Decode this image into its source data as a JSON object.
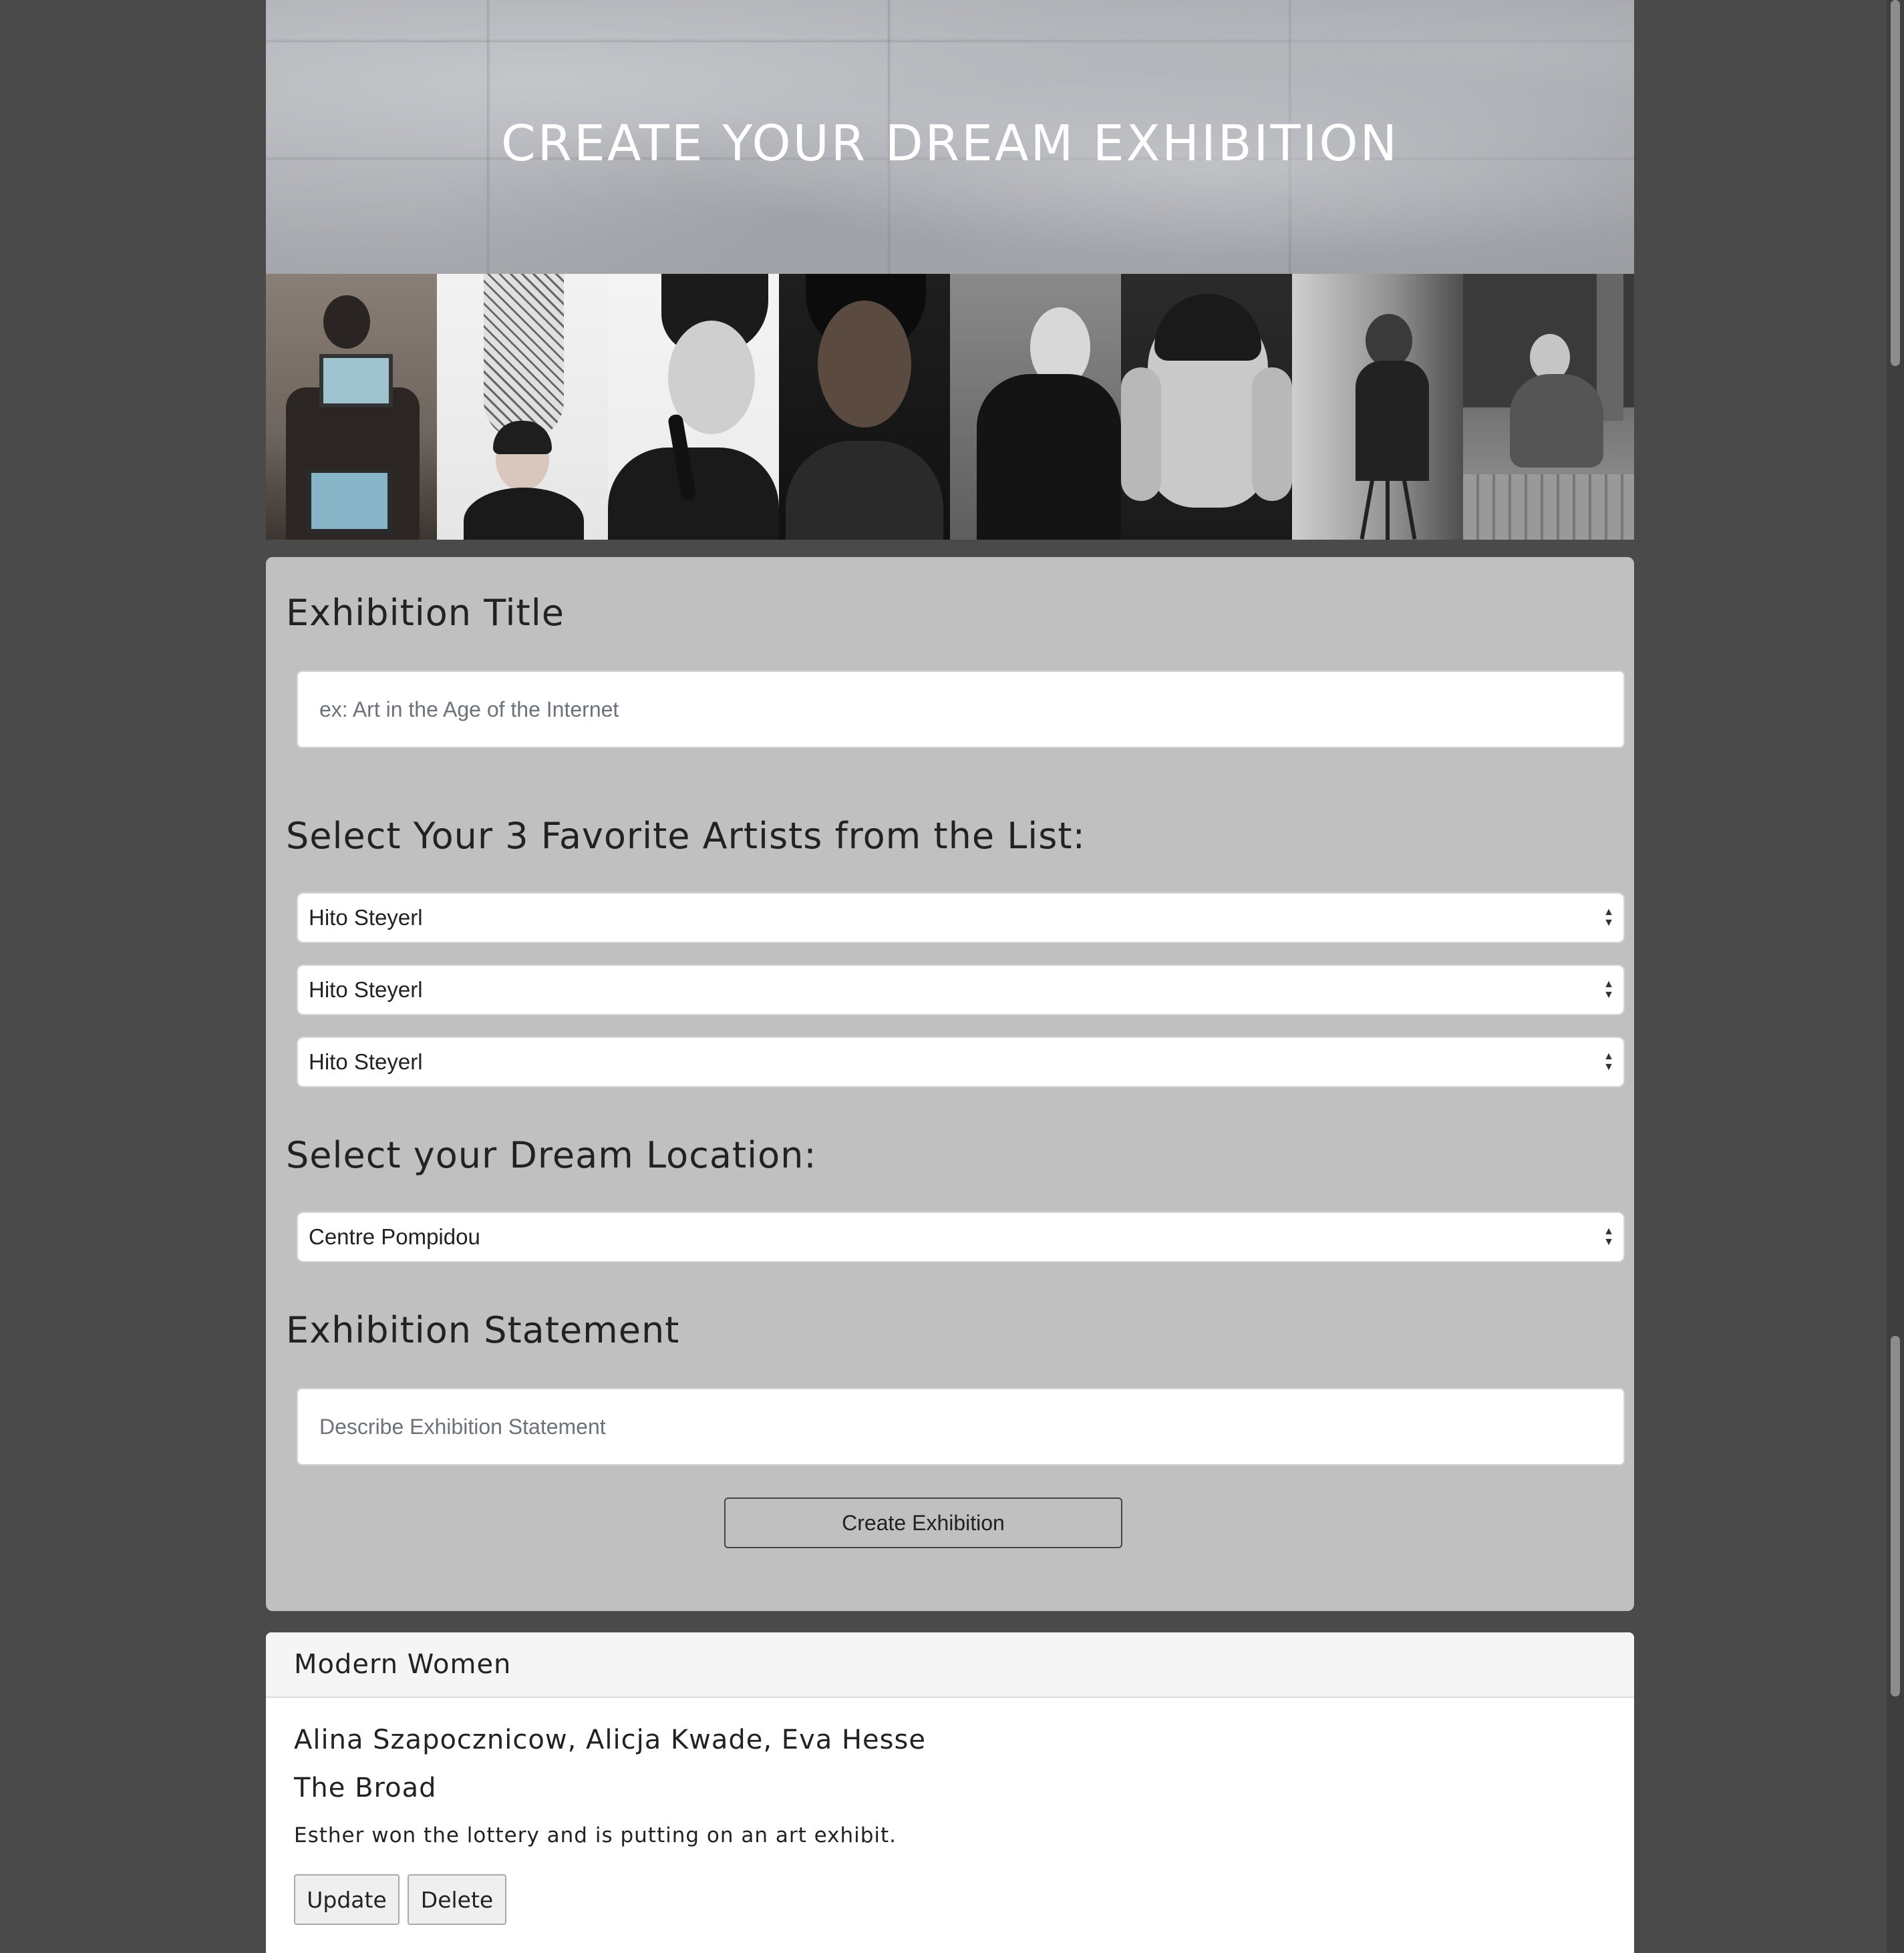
{
  "hero": {
    "title": "CREATE YOUR DREAM EXHIBITION"
  },
  "portraits": [
    {
      "name": "artist-photo-1"
    },
    {
      "name": "artist-photo-2"
    },
    {
      "name": "artist-photo-3"
    },
    {
      "name": "artist-photo-4"
    },
    {
      "name": "artist-photo-5"
    },
    {
      "name": "artist-photo-6"
    },
    {
      "name": "artist-photo-7"
    },
    {
      "name": "artist-photo-8"
    }
  ],
  "form": {
    "title_label": "Exhibition Title",
    "title_placeholder": "ex: Art in the Age of the Internet",
    "artists_label": "Select Your 3 Favorite Artists from the List:",
    "artist_selects": [
      "Hito Steyerl",
      "Hito Steyerl",
      "Hito Steyerl"
    ],
    "location_label": "Select your Dream Location:",
    "location_select": "Centre Pompidou",
    "statement_label": "Exhibition Statement",
    "statement_placeholder": "Describe Exhibition Statement",
    "create_button": "Create Exhibition"
  },
  "exhibition_card": {
    "title": "Modern Women",
    "artists": "Alina Szapocznicow, Alicja Kwade, Eva Hesse",
    "location": "The Broad",
    "statement": "Esther won the lottery and is putting on an art exhibit.",
    "update_button": "Update",
    "delete_button": "Delete"
  },
  "colors": {
    "background": "#4a4a4b",
    "panel": "#c0c0c0",
    "card": "#ffffff"
  }
}
